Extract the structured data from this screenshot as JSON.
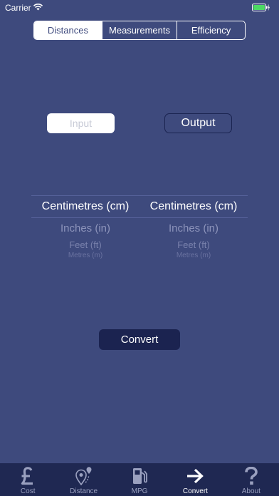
{
  "status_bar": {
    "carrier": "Carrier",
    "wifi_icon": "wifi-icon",
    "battery_icon": "battery-charging-icon"
  },
  "segmented": {
    "items": [
      "Distances",
      "Measurements",
      "Efficiency"
    ],
    "selected": "Distances"
  },
  "io_buttons": {
    "input_label": "Input",
    "output_label": "Output"
  },
  "picker_left": {
    "selected": "Centimetres (cm)",
    "options": [
      "Inches (in)",
      "Feet (ft)",
      "Metres (m)"
    ]
  },
  "picker_right": {
    "selected": "Centimetres (cm)",
    "options": [
      "Inches (in)",
      "Feet (ft)",
      "Metres (m)"
    ]
  },
  "convert_label": "Convert",
  "tab_bar": {
    "tabs": [
      {
        "label": "Cost",
        "icon": "pound-icon"
      },
      {
        "label": "Distance",
        "icon": "map-pin-icon"
      },
      {
        "label": "MPG",
        "icon": "fuel-pump-icon"
      },
      {
        "label": "Convert",
        "icon": "arrow-right-icon"
      },
      {
        "label": "About",
        "icon": "question-icon"
      }
    ],
    "active": "Convert"
  },
  "colors": {
    "background": "#3e4a7d",
    "tab_bar": "#1f2852",
    "accent_dark": "#1b2350",
    "battery": "#4cd964"
  }
}
